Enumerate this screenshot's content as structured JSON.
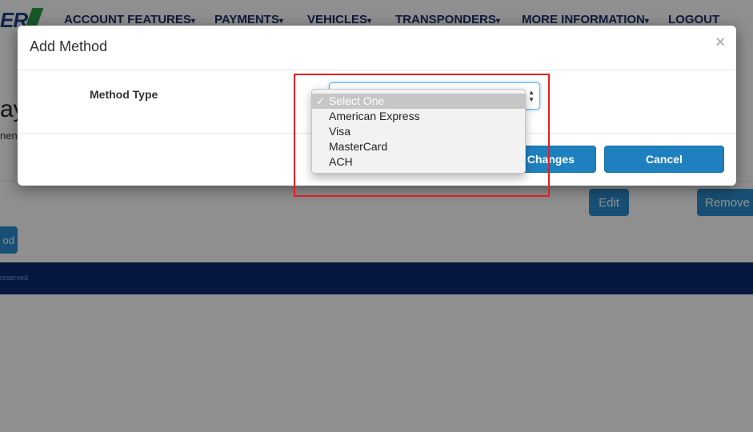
{
  "logo": {
    "text": "ER"
  },
  "nav": [
    {
      "label": "ACCOUNT FEATURES",
      "caret": "▾"
    },
    {
      "label": "PAYMENTS",
      "caret": "▾"
    },
    {
      "label": "VEHICLES",
      "caret": "▾"
    },
    {
      "label": "TRANSPONDERS",
      "caret": "▾"
    },
    {
      "label": "MORE INFORMATION",
      "caret": "▾"
    },
    {
      "label": "LOGOUT",
      "caret": ""
    }
  ],
  "page": {
    "heading_fragment": "ay",
    "subtext_fragment": "nent"
  },
  "background_buttons": {
    "edit": "Edit",
    "remove": "Remove",
    "add_fragment": "od"
  },
  "footer": {
    "text_fragment": "reserved"
  },
  "modal": {
    "title": "Add Method",
    "close_symbol": "×",
    "method_type_label": "Method Type",
    "save_button_fragment": "e Changes",
    "cancel_button": "Cancel"
  },
  "dropdown": {
    "check_mark": "✓",
    "selected_index": 0,
    "options": [
      "Select One",
      "American Express",
      "Visa",
      "MasterCard",
      "ACH"
    ]
  },
  "colors": {
    "overlay": "#8f8f8f",
    "primary_button": "#1f80bf",
    "nav_text": "#1d2f6b",
    "footer": "#0b2a72",
    "highlight": "#e02020"
  }
}
